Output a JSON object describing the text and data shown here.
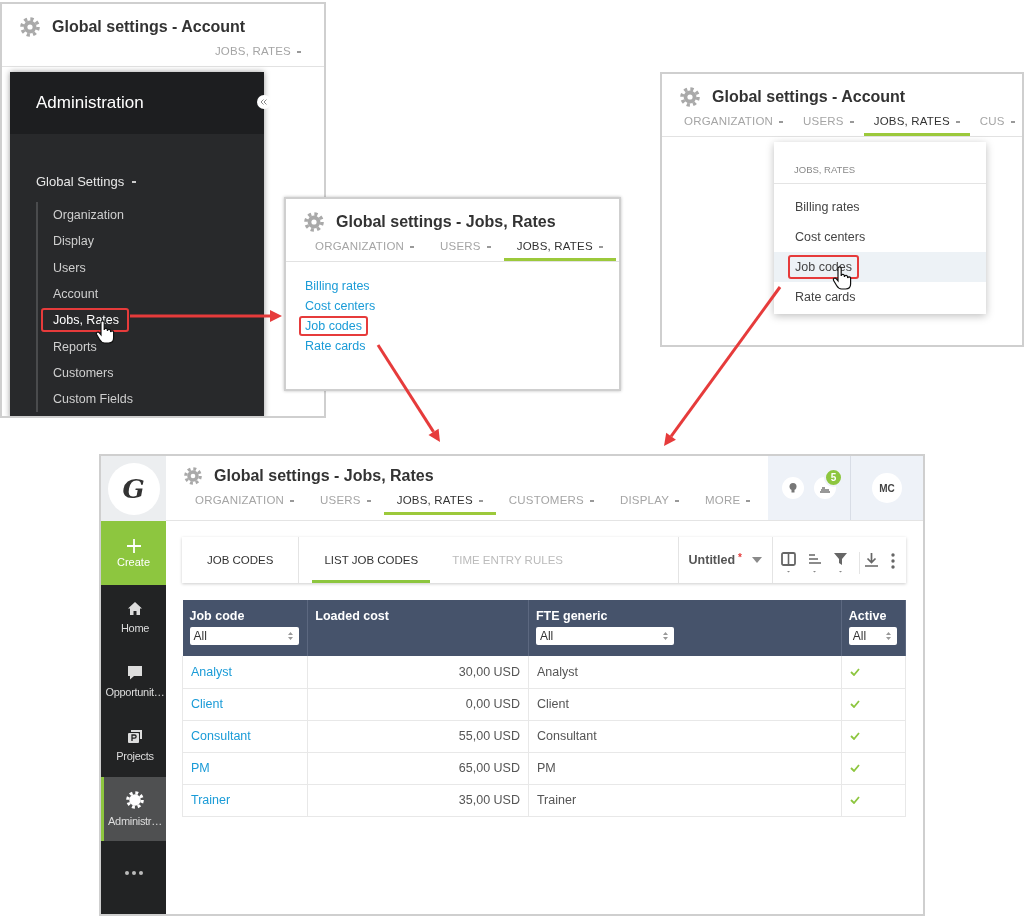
{
  "admin_window": {
    "title": "Global settings - Account",
    "tabs": [
      {
        "label": "JOBS, RATES",
        "selected": false
      }
    ],
    "drawer": {
      "title": "Administration",
      "section": "Global Settings",
      "items": [
        {
          "label": "Organization",
          "highlighted": false,
          "hovered": false
        },
        {
          "label": "Display",
          "highlighted": false,
          "hovered": false
        },
        {
          "label": "Users",
          "highlighted": false,
          "hovered": false
        },
        {
          "label": "Account",
          "highlighted": false,
          "hovered": false
        },
        {
          "label": "Jobs, Rates",
          "highlighted": true,
          "hovered": true
        },
        {
          "label": "Reports",
          "highlighted": false,
          "hovered": false
        },
        {
          "label": "Customers",
          "highlighted": false,
          "hovered": false
        },
        {
          "label": "Custom Fields",
          "highlighted": false,
          "hovered": false
        }
      ]
    }
  },
  "jobs_rates_window": {
    "title": "Global settings - Jobs, Rates",
    "tabs": [
      {
        "label": "ORGANIZATION",
        "selected": false
      },
      {
        "label": "USERS",
        "selected": false
      },
      {
        "label": "JOBS, RATES",
        "selected": true
      }
    ],
    "links": [
      {
        "label": "Billing rates",
        "highlighted": false
      },
      {
        "label": "Cost centers",
        "highlighted": false
      },
      {
        "label": "Job codes",
        "highlighted": true
      },
      {
        "label": "Rate cards",
        "highlighted": false
      }
    ]
  },
  "dropdown_window": {
    "title": "Global settings - Account",
    "tabs": [
      {
        "label": "ORGANIZATION",
        "selected": false
      },
      {
        "label": "USERS",
        "selected": false
      },
      {
        "label": "JOBS, RATES",
        "selected": true
      },
      {
        "label": "CUS",
        "selected": false
      }
    ],
    "dropdown": {
      "heading": "JOBS, RATES",
      "items": [
        {
          "label": "Billing rates",
          "highlighted": false,
          "hovered": false
        },
        {
          "label": "Cost centers",
          "highlighted": false,
          "hovered": false
        },
        {
          "label": "Job codes",
          "highlighted": true,
          "hovered": true
        },
        {
          "label": "Rate cards",
          "highlighted": false,
          "hovered": false
        }
      ]
    }
  },
  "app_window": {
    "logo": "G",
    "create": "Create",
    "nav": [
      {
        "label": "Home",
        "kind": "home",
        "selected": false
      },
      {
        "label": "Opportunit…",
        "kind": "chat",
        "selected": false
      },
      {
        "label": "Projects",
        "kind": "projects",
        "selected": false
      },
      {
        "label": "Administr…",
        "kind": "gear",
        "selected": true
      }
    ],
    "title": "Global settings - Jobs, Rates",
    "tabs": [
      {
        "label": "ORGANIZATION",
        "selected": false
      },
      {
        "label": "USERS",
        "selected": false
      },
      {
        "label": "JOBS, RATES",
        "selected": true
      },
      {
        "label": "CUSTOMERS",
        "selected": false
      },
      {
        "label": "DISPLAY",
        "selected": false
      },
      {
        "label": "MORE",
        "selected": false
      }
    ],
    "notification_count": "5",
    "avatar": "MC",
    "section_title": "JOB CODES",
    "subtabs": [
      {
        "label": "LIST JOB CODES",
        "selected": true
      },
      {
        "label": "TIME ENTRY RULES",
        "selected": false
      }
    ],
    "view": {
      "name": "Untitled",
      "modified_mark": "*"
    },
    "table": {
      "columns": [
        {
          "label": "Job code",
          "filter": "All"
        },
        {
          "label": "Loaded cost"
        },
        {
          "label": "FTE generic",
          "filter": "All"
        },
        {
          "label": "Active",
          "filter": "All"
        }
      ],
      "rows": [
        {
          "job_code": "Analyst",
          "loaded_cost": "30,00 USD",
          "fte_generic": "Analyst",
          "active": true
        },
        {
          "job_code": "Client",
          "loaded_cost": "0,00 USD",
          "fte_generic": "Client",
          "active": true
        },
        {
          "job_code": "Consultant",
          "loaded_cost": "55,00 USD",
          "fte_generic": "Consultant",
          "active": true
        },
        {
          "job_code": "PM",
          "loaded_cost": "65,00 USD",
          "fte_generic": "PM",
          "active": true
        },
        {
          "job_code": "Trainer",
          "loaded_cost": "35,00 USD",
          "fte_generic": "Trainer",
          "active": true
        }
      ]
    }
  }
}
